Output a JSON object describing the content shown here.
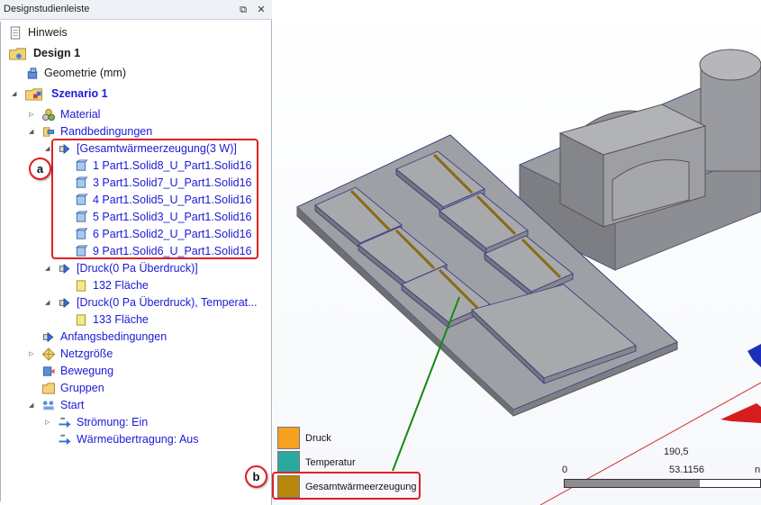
{
  "panel": {
    "title": "Designstudienleiste",
    "pin_icon": "pin-icon",
    "close_icon": "close-icon"
  },
  "tree": {
    "hinweis": "Hinweis",
    "design": "Design 1",
    "geometrie": "Geometrie (mm)",
    "szenario": "Szenario 1",
    "material": "Material",
    "randbedingungen": "Randbedingungen",
    "gesamt": "[Gesamtwärmeerzeugung(3 W)]",
    "solids": [
      "1 Part1.Solid8_U_Part1.Solid16",
      "3 Part1.Solid7_U_Part1.Solid16",
      "4 Part1.Solid5_U_Part1.Solid16",
      "5 Part1.Solid3_U_Part1.Solid16",
      "6 Part1.Solid2_U_Part1.Solid16",
      "9 Part1.Solid6_U_Part1.Solid16"
    ],
    "druck1": "[Druck(0 Pa Überdruck)]",
    "flaeche132": "132 Fläche",
    "druck2": "[Druck(0 Pa Überdruck), Temperat...",
    "flaeche133": "133 Fläche",
    "anfang": "Anfangsbedingungen",
    "netz": "Netzgröße",
    "bewegung": "Bewegung",
    "gruppen": "Gruppen",
    "start": "Start",
    "stroemung": "Strömung: Ein",
    "waerme": "Wärmeübertragung: Aus"
  },
  "callouts": {
    "a": "a",
    "b": "b"
  },
  "legend": [
    {
      "label": "Druck",
      "color": "#f5a21e"
    },
    {
      "label": "Temperatur",
      "color": "#2aa9a0"
    },
    {
      "label": "Gesamtwärmeerzeugung",
      "color": "#b8860b"
    }
  ],
  "scale": {
    "top_value": "190,5",
    "zero": "0",
    "mid": "53.1156",
    "unit_partial": "n"
  },
  "colors": {
    "highlight": "#e02020",
    "tree_blue": "#1a1ad6",
    "leader_line": "#138a13"
  }
}
